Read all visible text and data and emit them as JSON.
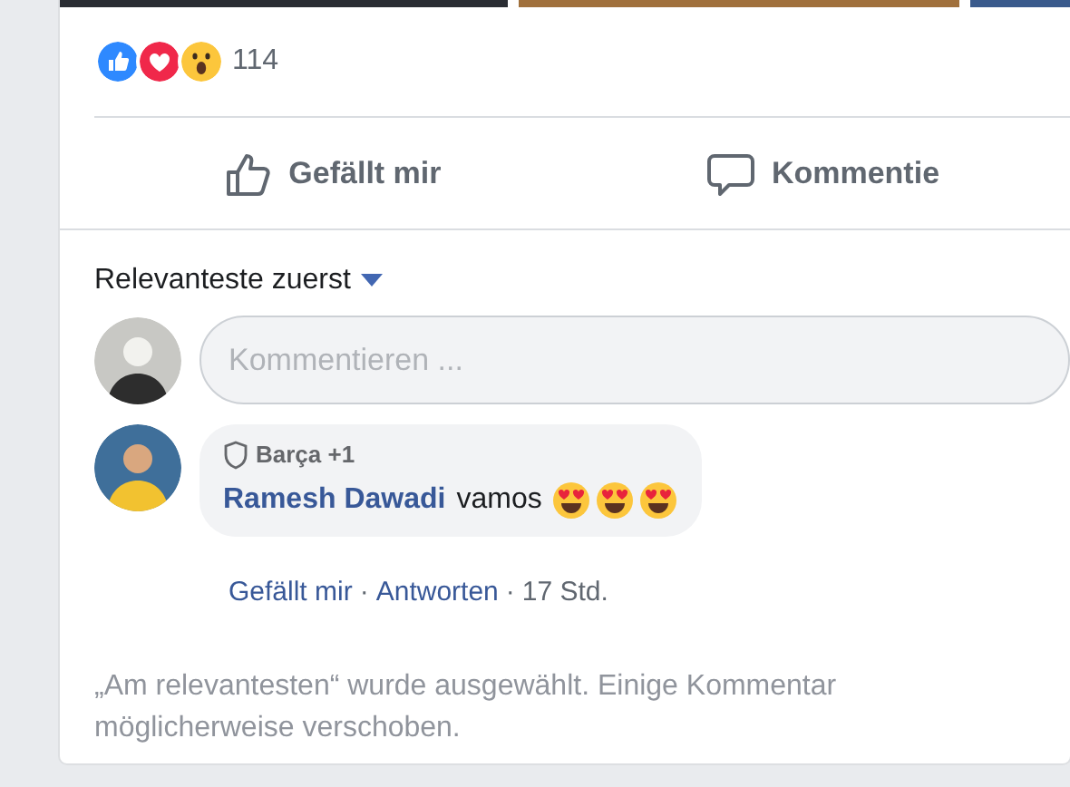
{
  "post": {
    "reactions": [
      {
        "kind": "like"
      },
      {
        "kind": "love"
      },
      {
        "kind": "wow"
      }
    ],
    "reaction_count": "114",
    "actions": [
      {
        "kind": "like",
        "label": "Gefällt mir"
      },
      {
        "kind": "comment",
        "label": "Kommentie"
      }
    ]
  },
  "comments_section": {
    "sort_label": "Relevanteste zuerst",
    "composer": {
      "placeholder": "Kommentieren ..."
    },
    "comments": [
      {
        "badge": "Barça +1",
        "author": "Ramesh Dawadi",
        "text": "vamos",
        "emojis": [
          {
            "kind": "heart-eyes"
          },
          {
            "kind": "heart-eyes"
          },
          {
            "kind": "heart-eyes"
          }
        ],
        "actions": [
          {
            "kind": "link",
            "label": "Gefällt mir"
          },
          {
            "kind": "link",
            "label": "Antworten"
          },
          {
            "kind": "time",
            "label": "17 Std."
          }
        ],
        "separator": "·"
      }
    ],
    "notice_lines": [
      "„Am relevantesten“ wurde ausgewählt. Einige Kommentar",
      "möglicherweise verschoben."
    ]
  }
}
